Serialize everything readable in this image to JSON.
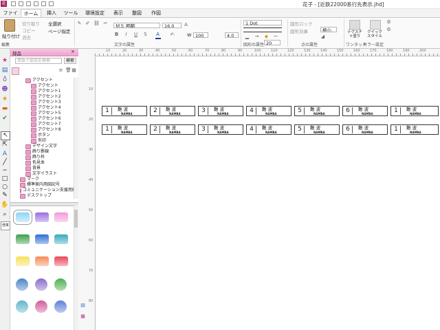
{
  "window": {
    "title": "花子 - [近鉄22000系行先表示.jhd]",
    "app_icon_label": "花"
  },
  "tabs": [
    "ファイル",
    "ホーム",
    "挿入",
    "ツール",
    "環境設定",
    "表示",
    "整図",
    "作図"
  ],
  "active_tab": "ホーム",
  "ribbon": {
    "paste": "貼り付け",
    "cut": "切り取り",
    "copy": "コピー",
    "erase": "消去",
    "select_all": "全選択",
    "page_settings": "ページ指定",
    "font_name": "ＭＳ 明朝",
    "font_size": "16.0",
    "line_style": "1 Dot",
    "shadow": "図形ロック",
    "figure_effect": "図形効果",
    "size_small": "極小",
    "textture": "テクスチャ塗り",
    "quick_style": "クイックスタイル",
    "one_touch": "ワンタッチ",
    "color_label": "カラー設定",
    "ratio_w": "100",
    "ratio_h": "4.0",
    "angle": "20",
    "groups": {
      "edit": "編集",
      "text": "文字の属性",
      "shape": "図形の属性",
      "point": "点の属性"
    }
  },
  "parts_panel": {
    "title": "部品",
    "search_placeholder": "単語で部品を検索",
    "search_button": "検索",
    "tree": [
      {
        "label": "アクセント",
        "indent": 1
      },
      {
        "label": "アクセント",
        "indent": 2
      },
      {
        "label": "アクセント1",
        "indent": 2
      },
      {
        "label": "アクセント2",
        "indent": 2
      },
      {
        "label": "アクセント3",
        "indent": 2
      },
      {
        "label": "アクセント4",
        "indent": 2
      },
      {
        "label": "アクセント5",
        "indent": 2
      },
      {
        "label": "アクセント6",
        "indent": 2
      },
      {
        "label": "アクセント7",
        "indent": 2
      },
      {
        "label": "アクセント8",
        "indent": 2
      },
      {
        "label": "ボタン",
        "indent": 2
      },
      {
        "label": "矢印",
        "indent": 2
      },
      {
        "label": "デザイン文字",
        "indent": 1
      },
      {
        "label": "飾り罫線",
        "indent": 1
      },
      {
        "label": "飾り枠",
        "indent": 1
      },
      {
        "label": "色見本",
        "indent": 1
      },
      {
        "label": "背景",
        "indent": 1
      },
      {
        "label": "文字イラスト",
        "indent": 1
      },
      {
        "label": "マーク",
        "indent": 0
      },
      {
        "label": "標準案内用図記号",
        "indent": 0
      },
      {
        "label": "コミュニケーション支援用絵記号",
        "indent": 0
      },
      {
        "label": "デスクトップ",
        "indent": 0
      }
    ],
    "gallery_colors": [
      [
        "#8fd3f7",
        "#9b6fe0",
        "#f59ad8"
      ],
      [
        "#3aa04a",
        "#2f6fd6",
        "#38a9c0"
      ],
      [
        "#f6e15a",
        "#f48c5a",
        "#e8475a"
      ],
      [
        "#4c84c9",
        "#8a6cc8",
        "#4caf50"
      ],
      [
        "#5fb6c9",
        "#d35a9a",
        "#5c7fd9"
      ]
    ]
  },
  "ruler": {
    "h_ticks": [
      "10",
      "20",
      "30",
      "40",
      "50",
      "60",
      "70",
      "80",
      "90",
      "100",
      "110",
      "120",
      "130",
      "140",
      "150",
      "160",
      "170",
      "180",
      "190",
      "200"
    ],
    "v_ticks": [
      "10",
      "20",
      "30",
      "40",
      "50",
      "60",
      "70",
      "80"
    ]
  },
  "labels": {
    "station_kanji": "難 波",
    "station_roman": "NAMBA",
    "rows": [
      [
        "1",
        "2",
        "3",
        "4",
        "5",
        "6",
        "1"
      ],
      [
        "1",
        "2",
        "3",
        "4",
        "5",
        "6",
        "1"
      ]
    ]
  },
  "status": {
    "zoom_label": "倍率"
  }
}
